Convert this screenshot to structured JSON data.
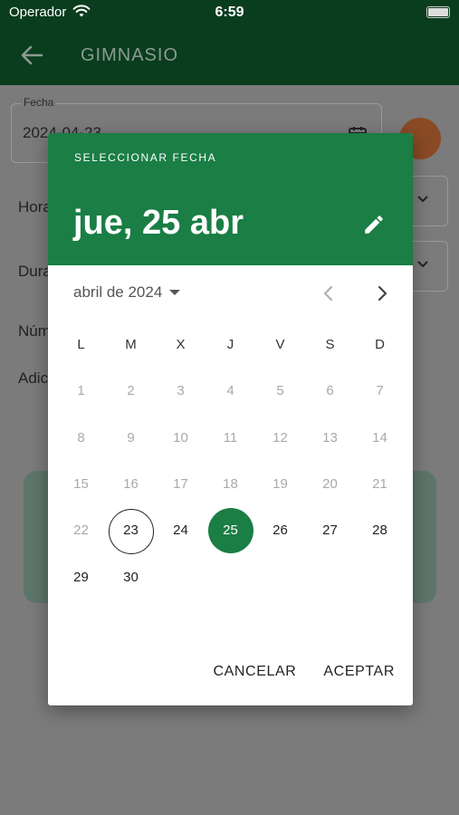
{
  "status": {
    "carrier": "Operador",
    "time": "6:59"
  },
  "app_bar": {
    "title": "GIMNASIO"
  },
  "form": {
    "date_label": "Fecha",
    "date_value": "2024-04-23",
    "labels": [
      "Hora",
      "Dura",
      "Núm",
      "Adic"
    ]
  },
  "dialog": {
    "help_text": "SELECCIONAR FECHA",
    "heading": "jue, 25 abr",
    "month_label": "abril de 2024",
    "weekdays": [
      "L",
      "M",
      "X",
      "J",
      "V",
      "S",
      "D"
    ],
    "weeks": [
      [
        {
          "d": "1",
          "s": "disabled"
        },
        {
          "d": "2",
          "s": "disabled"
        },
        {
          "d": "3",
          "s": "disabled"
        },
        {
          "d": "4",
          "s": "disabled"
        },
        {
          "d": "5",
          "s": "disabled"
        },
        {
          "d": "6",
          "s": "disabled"
        },
        {
          "d": "7",
          "s": "disabled"
        }
      ],
      [
        {
          "d": "8",
          "s": "disabled"
        },
        {
          "d": "9",
          "s": "disabled"
        },
        {
          "d": "10",
          "s": "disabled"
        },
        {
          "d": "11",
          "s": "disabled"
        },
        {
          "d": "12",
          "s": "disabled"
        },
        {
          "d": "13",
          "s": "disabled"
        },
        {
          "d": "14",
          "s": "disabled"
        }
      ],
      [
        {
          "d": "15",
          "s": "disabled"
        },
        {
          "d": "16",
          "s": "disabled"
        },
        {
          "d": "17",
          "s": "disabled"
        },
        {
          "d": "18",
          "s": "disabled"
        },
        {
          "d": "19",
          "s": "disabled"
        },
        {
          "d": "20",
          "s": "disabled"
        },
        {
          "d": "21",
          "s": "disabled"
        }
      ],
      [
        {
          "d": "22",
          "s": "disabled"
        },
        {
          "d": "23",
          "s": "today"
        },
        {
          "d": "24",
          "s": "enabled"
        },
        {
          "d": "25",
          "s": "selected"
        },
        {
          "d": "26",
          "s": "enabled"
        },
        {
          "d": "27",
          "s": "enabled"
        },
        {
          "d": "28",
          "s": "enabled"
        }
      ],
      [
        {
          "d": "29",
          "s": "enabled"
        },
        {
          "d": "30",
          "s": "enabled"
        },
        {
          "d": "",
          "s": "empty"
        },
        {
          "d": "",
          "s": "empty"
        },
        {
          "d": "",
          "s": "empty"
        },
        {
          "d": "",
          "s": "empty"
        },
        {
          "d": "",
          "s": "empty"
        }
      ]
    ],
    "cancel_label": "CANCELAR",
    "accept_label": "ACEPTAR"
  },
  "colors": {
    "primary": "#1a7e45",
    "app_bar": "#0a3d1e",
    "scrim": "#7b7b7b",
    "accent": "#8a4a25"
  },
  "icons": [
    "wifi-icon",
    "battery-icon",
    "back-arrow-icon",
    "calendar-icon",
    "edit-pencil-icon",
    "chevron-left-icon",
    "chevron-right-icon",
    "caret-down-icon",
    "dropdown-arrow-icon"
  ]
}
